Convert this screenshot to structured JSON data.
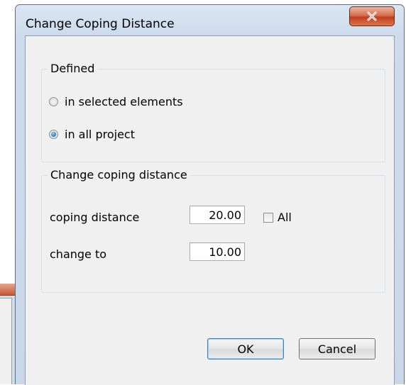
{
  "dialog": {
    "title": "Change Coping Distance",
    "close_icon": "close-x-icon"
  },
  "defined_group": {
    "label": "Defined",
    "options": [
      {
        "label": "in selected elements",
        "checked": false
      },
      {
        "label": "in all project",
        "checked": true
      }
    ]
  },
  "change_group": {
    "label": "Change coping distance",
    "coping_distance": {
      "label": "coping distance",
      "value": "20.00"
    },
    "change_to": {
      "label": "change to",
      "value": "10.00"
    },
    "all_checkbox": {
      "label": "All",
      "checked": false
    }
  },
  "buttons": {
    "ok": "OK",
    "cancel": "Cancel"
  },
  "colors": {
    "close_button": "#c9462a",
    "frame": "#cddbec"
  }
}
